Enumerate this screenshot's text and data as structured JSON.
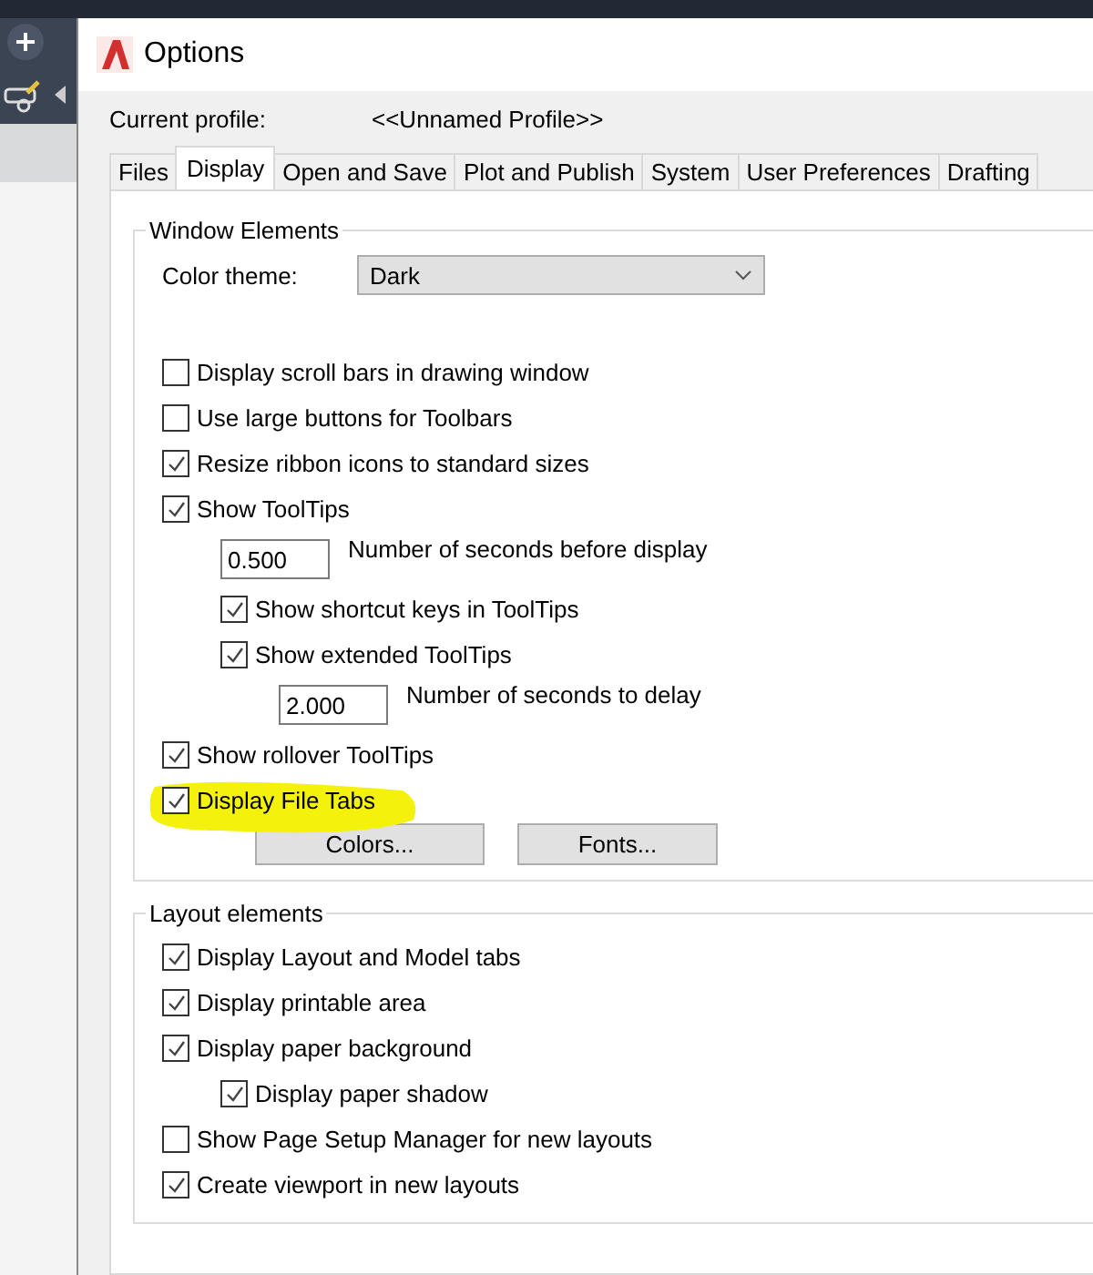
{
  "window": {
    "title": "Options"
  },
  "profile": {
    "label": "Current profile:",
    "value": "<<Unnamed Profile>>"
  },
  "tabs": [
    {
      "label": "Files",
      "selected": false
    },
    {
      "label": "Display",
      "selected": true
    },
    {
      "label": "Open and Save",
      "selected": false
    },
    {
      "label": "Plot and Publish",
      "selected": false
    },
    {
      "label": "System",
      "selected": false
    },
    {
      "label": "User Preferences",
      "selected": false
    },
    {
      "label": "Drafting",
      "selected": false
    }
  ],
  "window_elements": {
    "title": "Window Elements",
    "color_theme": {
      "label": "Color theme:",
      "value": "Dark"
    },
    "items": [
      {
        "kind": "checkbox",
        "label": "Display scroll bars in drawing window",
        "checked": false
      },
      {
        "kind": "checkbox",
        "label": "Use large buttons for Toolbars",
        "checked": false
      },
      {
        "kind": "checkbox",
        "label": "Resize ribbon icons to standard sizes",
        "checked": true
      },
      {
        "kind": "checkbox",
        "label": "Show ToolTips",
        "checked": true,
        "children": [
          {
            "kind": "field",
            "value": "0.500",
            "label": "Number of seconds before display"
          },
          {
            "kind": "checkbox",
            "label": "Show shortcut keys in ToolTips",
            "checked": true
          },
          {
            "kind": "checkbox",
            "label": "Show extended ToolTips",
            "checked": true,
            "children": [
              {
                "kind": "field",
                "value": "2.000",
                "label": "Number of seconds to delay"
              }
            ]
          }
        ]
      },
      {
        "kind": "checkbox",
        "label": "Show rollover ToolTips",
        "checked": true
      },
      {
        "kind": "checkbox",
        "label": "Display File Tabs",
        "checked": true,
        "highlighted": true
      }
    ],
    "buttons": [
      "Colors...",
      "Fonts..."
    ]
  },
  "layout_elements": {
    "title": "Layout elements",
    "items": [
      {
        "kind": "checkbox",
        "label": "Display Layout and Model tabs",
        "checked": true
      },
      {
        "kind": "checkbox",
        "label": "Display printable area",
        "checked": true
      },
      {
        "kind": "checkbox",
        "label": "Display paper background",
        "checked": true,
        "children": [
          {
            "kind": "checkbox",
            "label": "Display paper shadow",
            "checked": true
          }
        ]
      },
      {
        "kind": "checkbox",
        "label": "Show Page Setup Manager for new layouts",
        "checked": false
      },
      {
        "kind": "checkbox",
        "label": "Create viewport in new layouts",
        "checked": true
      }
    ]
  }
}
